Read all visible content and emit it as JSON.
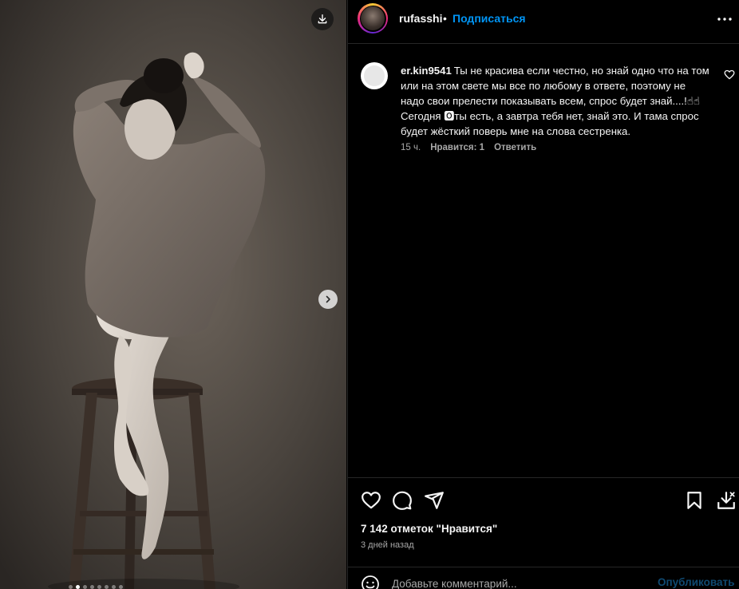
{
  "post": {
    "username": "rufasshi",
    "separator": "•",
    "follow_label": "Подписаться",
    "image_dots": 8,
    "active_dot": 1
  },
  "comment": {
    "username": "er.kin9541",
    "text": "Ты не красива если честно, но знай одно что на том или на этом свете мы все по любому в ответе, поэтому не надо свои прелести показывать всем, спрос будет знай....!☝☝Сегодня 🅾ты есть, а завтра тебя нет, знай это. И тама спрос будет жёсткий поверь мне на слова сестренка.",
    "time": "15 ч.",
    "likes_label": "Нравится: 1",
    "reply_label": "Ответить"
  },
  "footer": {
    "likes": "7 142 отметок \"Нравится\"",
    "time_ago": "3 дней назад",
    "comment_placeholder": "Добавьте комментарий...",
    "publish_label": "Опубликовать"
  },
  "icons": {
    "download": "download-icon",
    "next": "chevron-right-icon",
    "more": "more-options-icon",
    "heart": "heart-icon",
    "comment": "comment-icon",
    "share": "share-icon",
    "save": "bookmark-icon",
    "save_alt": "save-download-icon",
    "emoji": "emoji-icon"
  },
  "colors": {
    "accent": "#0095f6",
    "publish_disabled": "#0f4a72",
    "muted": "#a8a8a8",
    "background": "#000000"
  }
}
